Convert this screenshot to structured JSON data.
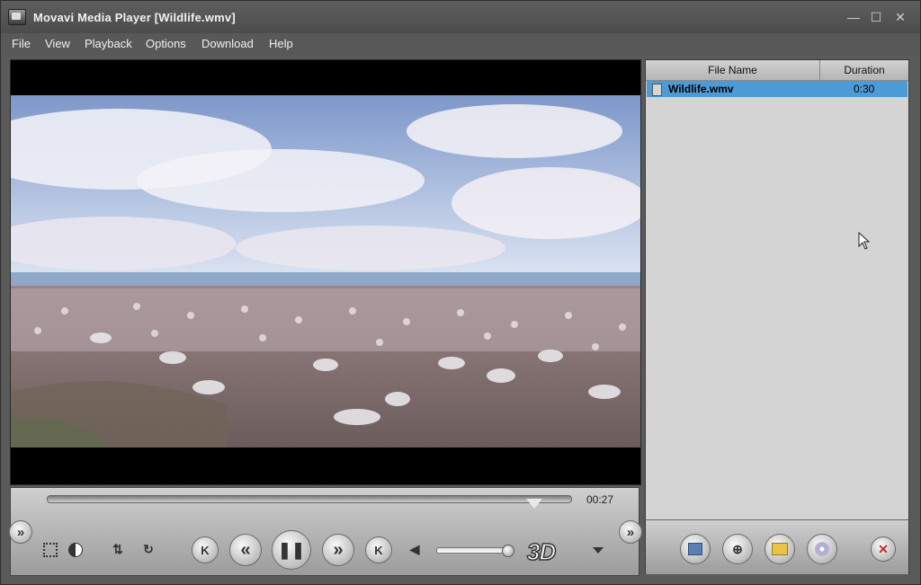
{
  "window": {
    "title": "Movavi Media Player [Wildlife.wmv]",
    "controls": {
      "minimize": "—",
      "maximize": "☐",
      "close": "✕"
    }
  },
  "menu": {
    "items": [
      "File",
      "View",
      "Playback",
      "Options",
      "Download",
      "Help"
    ]
  },
  "player": {
    "current_time": "00:27",
    "progress_fraction": 0.93,
    "volume_fraction": 0.95,
    "badge": "3D",
    "buttons": {
      "expand_left": "»",
      "expand_right": "»",
      "previous": "K",
      "rewind": "«",
      "pause": "❚❚",
      "forward": "»",
      "next": "K"
    },
    "icons": [
      "fullscreen-icon",
      "contrast-icon",
      "swap-icon",
      "rotate-icon",
      "speaker-icon"
    ]
  },
  "playlist": {
    "columns": {
      "name": "File Name",
      "duration": "Duration"
    },
    "rows": [
      {
        "name": "Wildlife.wmv",
        "duration": "0:30",
        "selected": true
      }
    ],
    "toolbar_icons": [
      "add-video-icon",
      "add-stream-icon",
      "add-folder-icon",
      "add-disc-icon",
      "remove-icon"
    ]
  },
  "colors": {
    "selection": "#4d9bd6",
    "remove_button": "#c62828"
  }
}
